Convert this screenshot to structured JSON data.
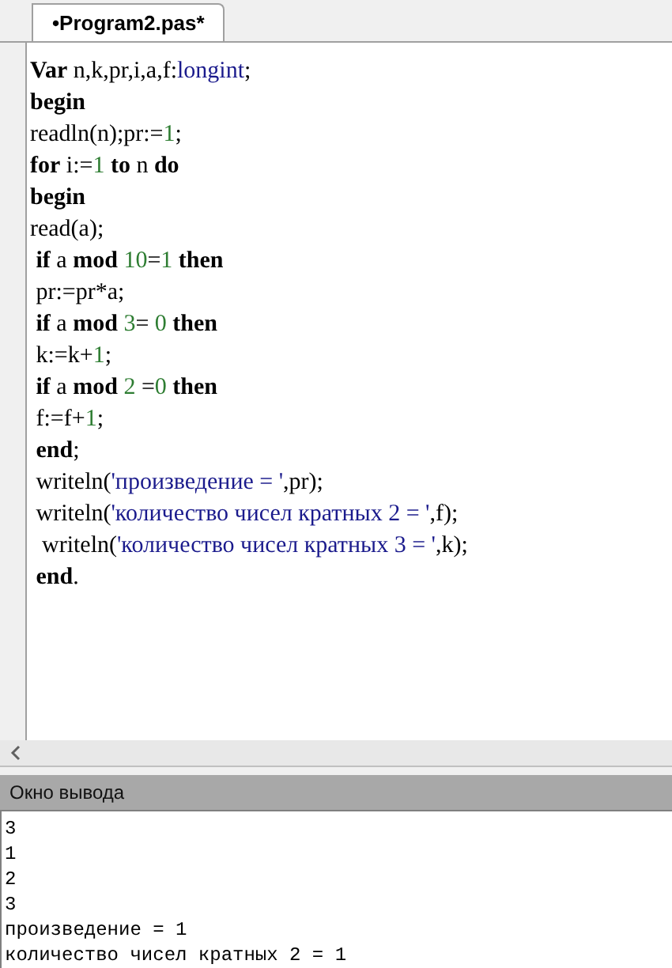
{
  "tabs": [
    {
      "label": "•Program2.pas*",
      "selected": true
    }
  ],
  "code_lines": [
    [
      {
        "kind": "keyword",
        "text": "Var"
      },
      {
        "kind": "ident",
        "text": " n,k,pr,i,a,f:"
      },
      {
        "kind": "type",
        "text": "longint"
      },
      {
        "kind": "ident",
        "text": ";"
      }
    ],
    [
      {
        "kind": "keyword",
        "text": "begin"
      }
    ],
    [
      {
        "kind": "ident",
        "text": "readln(n);pr:="
      },
      {
        "kind": "number",
        "text": "1"
      },
      {
        "kind": "ident",
        "text": ";"
      }
    ],
    [
      {
        "kind": "keyword",
        "text": "for"
      },
      {
        "kind": "ident",
        "text": " i:="
      },
      {
        "kind": "number",
        "text": "1"
      },
      {
        "kind": "keyword",
        "text": " to"
      },
      {
        "kind": "ident",
        "text": " n "
      },
      {
        "kind": "keyword",
        "text": "do"
      }
    ],
    [
      {
        "kind": "keyword",
        "text": "begin"
      }
    ],
    [
      {
        "kind": "ident",
        "text": "read(a);"
      }
    ],
    [
      {
        "kind": "keyword",
        "text": " if"
      },
      {
        "kind": "ident",
        "text": " a "
      },
      {
        "kind": "keyword",
        "text": "mod "
      },
      {
        "kind": "number",
        "text": "10"
      },
      {
        "kind": "ident",
        "text": "="
      },
      {
        "kind": "number",
        "text": "1"
      },
      {
        "kind": "keyword",
        "text": " then"
      }
    ],
    [
      {
        "kind": "ident",
        "text": " pr:=pr*a;"
      }
    ],
    [
      {
        "kind": "keyword",
        "text": " if"
      },
      {
        "kind": "ident",
        "text": " a "
      },
      {
        "kind": "keyword",
        "text": "mod "
      },
      {
        "kind": "number",
        "text": "3"
      },
      {
        "kind": "ident",
        "text": "= "
      },
      {
        "kind": "number",
        "text": "0"
      },
      {
        "kind": "keyword",
        "text": " then"
      }
    ],
    [
      {
        "kind": "ident",
        "text": " k:=k+"
      },
      {
        "kind": "number",
        "text": "1"
      },
      {
        "kind": "ident",
        "text": ";"
      }
    ],
    [
      {
        "kind": "keyword",
        "text": " if"
      },
      {
        "kind": "ident",
        "text": " a "
      },
      {
        "kind": "keyword",
        "text": "mod "
      },
      {
        "kind": "number",
        "text": "2"
      },
      {
        "kind": "ident",
        "text": " ="
      },
      {
        "kind": "number",
        "text": "0"
      },
      {
        "kind": "keyword",
        "text": " then"
      }
    ],
    [
      {
        "kind": "ident",
        "text": " f:=f+"
      },
      {
        "kind": "number",
        "text": "1"
      },
      {
        "kind": "ident",
        "text": ";"
      }
    ],
    [
      {
        "kind": "keyword",
        "text": " end"
      },
      {
        "kind": "ident",
        "text": ";"
      }
    ],
    [
      {
        "kind": "ident",
        "text": " writeln("
      },
      {
        "kind": "string",
        "text": "'произведение = '"
      },
      {
        "kind": "ident",
        "text": ",pr);"
      }
    ],
    [
      {
        "kind": "ident",
        "text": " writeln("
      },
      {
        "kind": "string",
        "text": "'количество чисел кратных 2 = '"
      },
      {
        "kind": "ident",
        "text": ",f);"
      }
    ],
    [
      {
        "kind": "ident",
        "text": "  writeln("
      },
      {
        "kind": "string",
        "text": "'количество чисел кратных 3 = '"
      },
      {
        "kind": "ident",
        "text": ",k);"
      }
    ],
    [
      {
        "kind": "keyword",
        "text": " end"
      },
      {
        "kind": "ident",
        "text": "."
      }
    ]
  ],
  "output_panel": {
    "title": "Окно вывода",
    "lines": [
      "3",
      "1",
      "2",
      "3",
      "произведение = 1",
      "количество чисел кратных 2 = 1"
    ]
  }
}
